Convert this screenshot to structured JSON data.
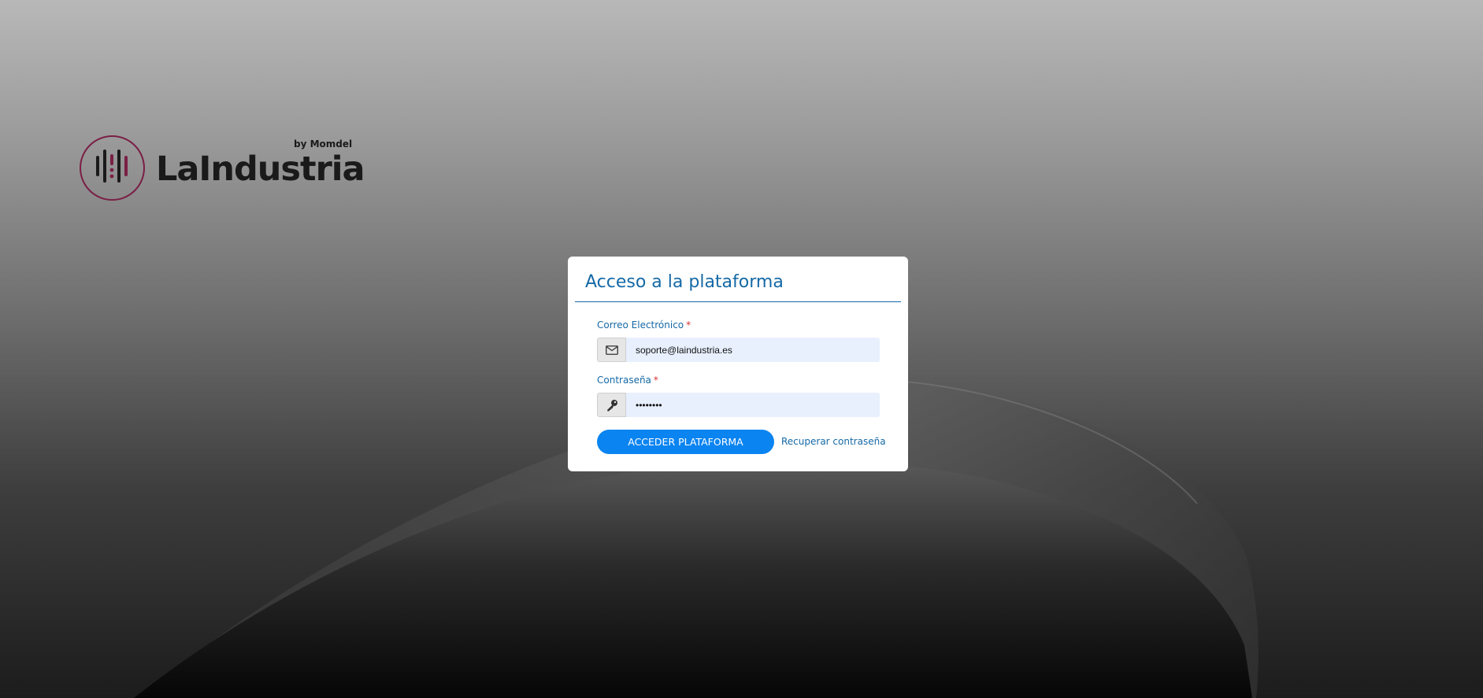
{
  "brand": {
    "name": "LaIndustria",
    "byline": "by Momdel",
    "accent_color": "#7a1f45"
  },
  "login_card": {
    "title": "Acceso a la plataforma",
    "email": {
      "label": "Correo Electrónico",
      "required_mark": "*",
      "icon": "envelope-icon",
      "value": "soporte@laindustria.es"
    },
    "password": {
      "label": "Contraseña",
      "required_mark": "*",
      "icon": "key-icon",
      "value": "••••••••"
    },
    "submit_label": "ACCEDER PLATAFORMA",
    "recover_label": "Recuperar contraseña",
    "colors": {
      "title": "#1569a6",
      "button": "#0a84f0",
      "required": "#d83232",
      "input_bg": "#e8f0fe"
    }
  }
}
